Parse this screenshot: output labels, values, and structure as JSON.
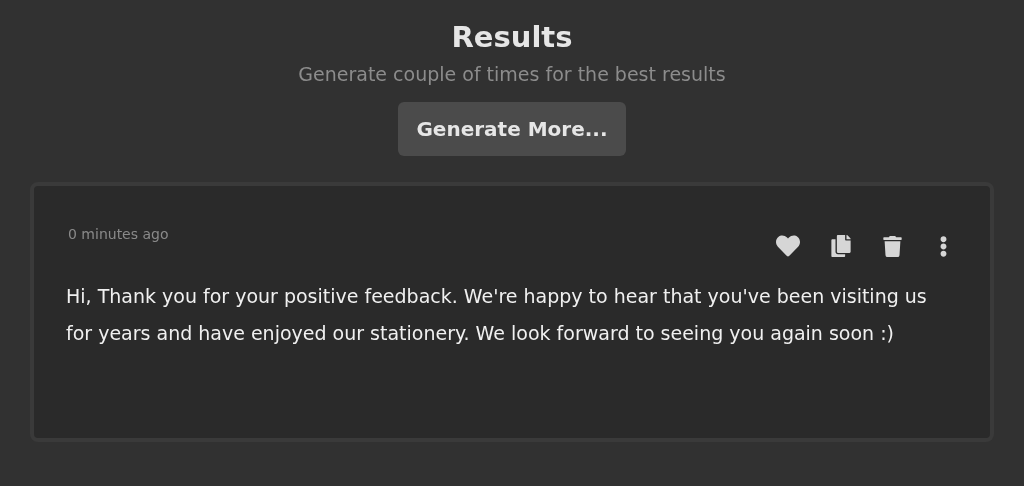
{
  "header": {
    "title": "Results",
    "subtitle": "Generate couple of times for the best results",
    "button": "Generate More..."
  },
  "results": [
    {
      "time": "0 minutes ago",
      "text": "Hi, Thank you for your positive feedback. We're happy to hear that you've been visiting us for years and have enjoyed our stationery. We look forward to seeing you again soon :)"
    }
  ]
}
